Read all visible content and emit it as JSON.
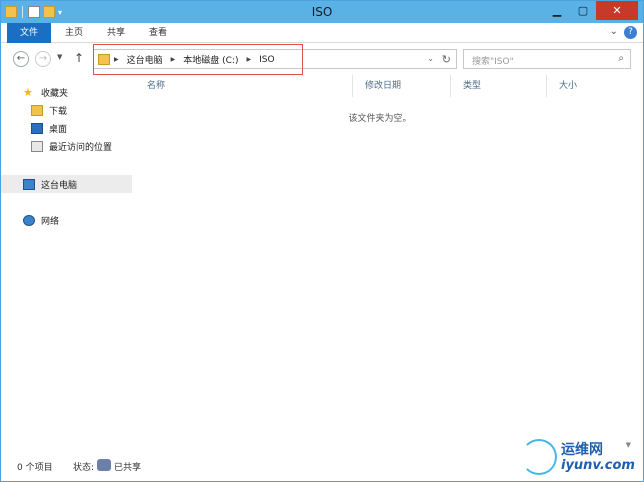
{
  "window": {
    "title": "ISO"
  },
  "ribbon": {
    "tabs": [
      "文件",
      "主页",
      "共享",
      "查看"
    ]
  },
  "address": {
    "crumbs": [
      "这台电脑",
      "本地磁盘 (C:)",
      "ISO"
    ]
  },
  "search": {
    "placeholder": "搜索\"ISO\""
  },
  "sidebar": {
    "items": [
      {
        "label": "收藏夹",
        "icon": "star-icon"
      },
      {
        "label": "下载",
        "icon": "download-folder-icon"
      },
      {
        "label": "桌面",
        "icon": "desktop-icon"
      },
      {
        "label": "最近访问的位置",
        "icon": "recent-places-icon"
      },
      {
        "label": "这台电脑",
        "icon": "computer-icon",
        "selected": true
      },
      {
        "label": "网络",
        "icon": "network-icon"
      }
    ]
  },
  "columns": [
    "名称",
    "修改日期",
    "类型",
    "大小"
  ],
  "content": {
    "empty_message": "该文件夹为空。"
  },
  "status": {
    "count": "0 个项目",
    "state_label": "状态:",
    "state_value": "已共享"
  },
  "watermark": {
    "cn": "运维网",
    "en": "iyunv.com"
  },
  "colors": {
    "title_bar": "#5ab1e6",
    "file_tab": "#1b6fc2",
    "close_button": "#c7392b",
    "highlight_box": "#e05050"
  }
}
